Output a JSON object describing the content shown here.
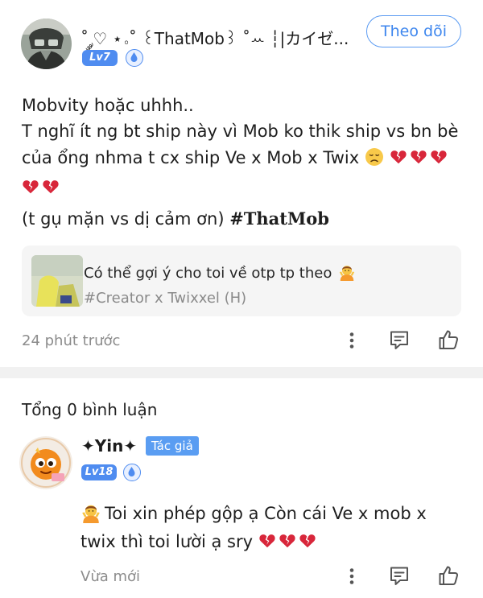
{
  "post": {
    "author": {
      "name": "˚ ༘♡ ⋆｡˚ ꒰ThatMob꒱ ˚ꕀ ┆|カイゼ...",
      "level": "Lv7",
      "follow_label": "Theo dõi"
    },
    "lines": [
      "Mobvity hoặc uhhh..",
      "T nghĩ ít ng bt ship này vì Mob ko thik ship vs bn bè",
      "của ổng nhma t cx ship Ve x Mob x Twix"
    ],
    "line5_prefix": "(t gụ mặn vs dị cảm ơn) ",
    "hashtag": "#ThatMob",
    "reference": {
      "title": "Có thể gợi ý cho toi về otp tp theo",
      "subtitle": "#Creator x Twixxel (H)"
    },
    "time": "24 phút trước"
  },
  "comments": {
    "header": "Tổng 0 bình luận",
    "items": [
      {
        "author": "✦Yin✦",
        "author_tag": "Tác giả",
        "level": "Lv18",
        "text_line1": "Toi xin phép gộp ạ Còn cái Ve x mob x",
        "text_line2": "twix thì toi lười ạ sry",
        "time": "Vừa mới"
      }
    ]
  },
  "icons": {
    "more": "more-vertical-icon",
    "comment": "comment-icon",
    "like": "thumbs-up-icon",
    "broken_heart": "broken-heart-emoji",
    "sad": "sad-face-emoji",
    "shrug": "person-gesture-emoji"
  },
  "colors": {
    "accent": "#4f8cf0",
    "follow_border": "#5b9bf2",
    "broken_heart": "#d8263a",
    "muted_text": "#8c8c8c",
    "divider": "#f1f1f1"
  }
}
